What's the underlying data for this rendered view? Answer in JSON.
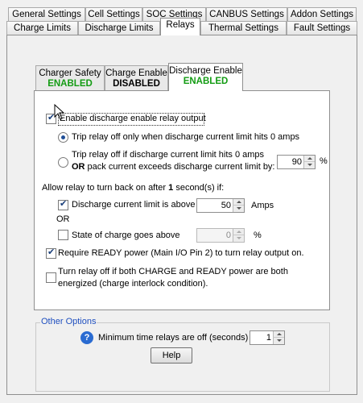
{
  "tabs_row1": [
    "General Settings",
    "Cell Settings",
    "SOC Settings",
    "CANBUS Settings",
    "Addon Settings"
  ],
  "tabs_row2": [
    "Charge Limits",
    "Discharge Limits",
    "Relays",
    "Thermal Settings",
    "Fault Settings"
  ],
  "selected_tab": "Relays",
  "inner_tabs": [
    {
      "title": "Charger Safety",
      "status": "ENABLED",
      "status_color": "#149c14"
    },
    {
      "title": "Charge Enable",
      "status": "DISABLED",
      "status_color": "#000000"
    },
    {
      "title": "Discharge Enable",
      "status": "ENABLED",
      "status_color": "#149c14"
    }
  ],
  "selected_inner_tab": "Discharge Enable",
  "enable_relay": {
    "label": "Enable discharge enable relay output",
    "checked": true
  },
  "trip_options": {
    "option1": {
      "label": "Trip relay off only when discharge current limit hits 0 amps",
      "checked": true
    },
    "option2": {
      "line1": "Trip relay off if discharge current limit hits 0 amps",
      "or": "OR",
      "line2": " pack current exceeds discharge current limit by:",
      "value": "90",
      "unit": "%",
      "checked": false
    }
  },
  "allow_back": {
    "prefix": "Allow relay to turn back on after ",
    "seconds": "1",
    "suffix": " second(s) if:"
  },
  "dcl_above": {
    "label": "Discharge current limit is above",
    "value": "50",
    "unit": "Amps",
    "checked": true
  },
  "or_label": "OR",
  "soc_above": {
    "label": "State of charge goes above",
    "value": "0",
    "unit": "%",
    "checked": false
  },
  "require_ready": {
    "label": "Require READY power (Main I/O Pin 2) to turn relay output on.",
    "checked": true
  },
  "turn_off_both": {
    "line1": "Turn relay off if both CHARGE and READY power are both",
    "line2": "energized (charge interlock condition).",
    "checked": false
  },
  "other_options": {
    "title": "Other Options",
    "min_time_label": "Minimum time relays are off (seconds)",
    "min_time_value": "1",
    "help_label": "Help",
    "help_icon": "question-icon"
  }
}
